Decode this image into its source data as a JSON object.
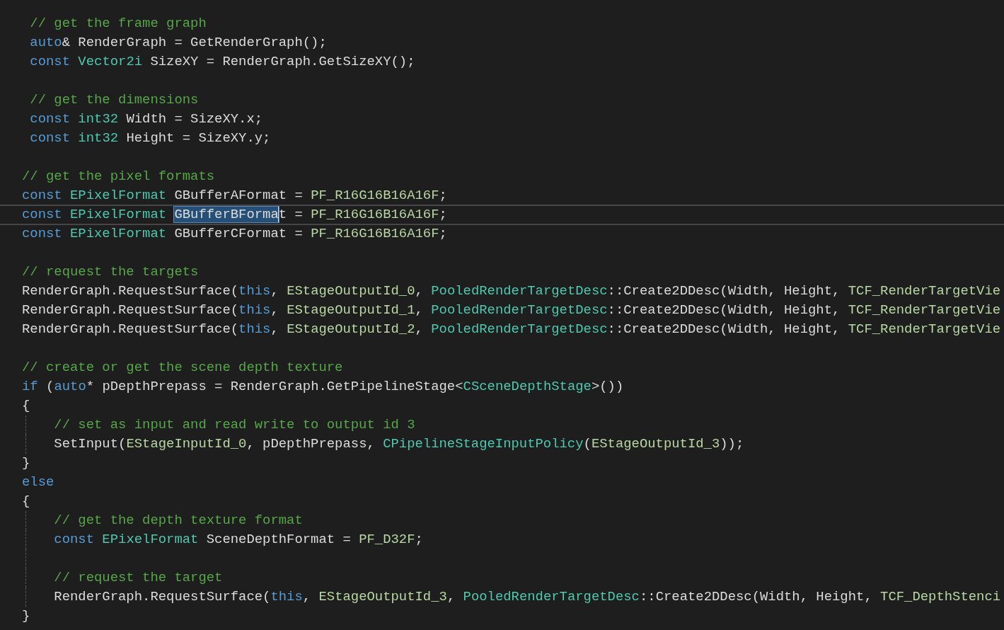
{
  "editor": {
    "lines": [
      {
        "current": false,
        "guide": false,
        "tokens": [
          {
            "kind": "comment",
            "text": " // get the frame graph"
          }
        ]
      },
      {
        "current": false,
        "guide": false,
        "tokens": [
          {
            "kind": "keyword",
            "text": " auto"
          },
          {
            "kind": "plain",
            "text": "& RenderGraph = GetRenderGraph();"
          }
        ]
      },
      {
        "current": false,
        "guide": false,
        "tokens": [
          {
            "kind": "keyword",
            "text": " const"
          },
          {
            "kind": "type",
            "text": " Vector2i"
          },
          {
            "kind": "plain",
            "text": " SizeXY = RenderGraph.GetSizeXY();"
          }
        ]
      },
      {
        "current": false,
        "guide": false
      },
      {
        "current": false,
        "guide": false,
        "tokens": [
          {
            "kind": "comment",
            "text": " // get the dimensions"
          }
        ]
      },
      {
        "current": false,
        "guide": false,
        "tokens": [
          {
            "kind": "keyword",
            "text": " const"
          },
          {
            "kind": "type",
            "text": " int32"
          },
          {
            "kind": "plain",
            "text": " Width = SizeXY.x;"
          }
        ]
      },
      {
        "current": false,
        "guide": false,
        "tokens": [
          {
            "kind": "keyword",
            "text": " const"
          },
          {
            "kind": "type",
            "text": " int32"
          },
          {
            "kind": "plain",
            "text": " Height = SizeXY.y;"
          }
        ]
      },
      {
        "current": false,
        "guide": false
      },
      {
        "current": false,
        "guide": false,
        "tokens": [
          {
            "kind": "comment",
            "text": "// get the pixel formats"
          }
        ]
      },
      {
        "current": false,
        "guide": false,
        "tokens": [
          {
            "kind": "keyword",
            "text": "const"
          },
          {
            "kind": "type",
            "text": " EPixelFormat"
          },
          {
            "kind": "plain",
            "text": " GBufferAFormat = "
          },
          {
            "kind": "enum",
            "text": "PF_R16G16B16A16F"
          },
          {
            "kind": "plain",
            "text": ";"
          }
        ]
      },
      {
        "current": true,
        "guide": false,
        "tokens": [
          {
            "kind": "keyword",
            "text": "const"
          },
          {
            "kind": "type",
            "text": " EPixelFormat "
          },
          {
            "kind": "selection",
            "text": "GBufferBForma"
          },
          {
            "kind": "plain",
            "text": "t = "
          },
          {
            "kind": "enum",
            "text": "PF_R16G16B16A16F"
          },
          {
            "kind": "plain",
            "text": ";"
          }
        ]
      },
      {
        "current": false,
        "guide": false,
        "tokens": [
          {
            "kind": "keyword",
            "text": "const"
          },
          {
            "kind": "type",
            "text": " EPixelFormat"
          },
          {
            "kind": "plain",
            "text": " GBufferCFormat = "
          },
          {
            "kind": "enum",
            "text": "PF_R16G16B16A16F"
          },
          {
            "kind": "plain",
            "text": ";"
          }
        ]
      },
      {
        "current": false,
        "guide": false
      },
      {
        "current": false,
        "guide": false,
        "tokens": [
          {
            "kind": "comment",
            "text": "// request the targets"
          }
        ]
      },
      {
        "current": false,
        "guide": false,
        "tokens": [
          {
            "kind": "plain",
            "text": "RenderGraph.RequestSurface("
          },
          {
            "kind": "keyword",
            "text": "this"
          },
          {
            "kind": "plain",
            "text": ", "
          },
          {
            "kind": "enum",
            "text": "EStageOutputId_0"
          },
          {
            "kind": "plain",
            "text": ", "
          },
          {
            "kind": "type",
            "text": "PooledRenderTargetDesc"
          },
          {
            "kind": "plain",
            "text": "::Create2DDesc(Width, Height, "
          },
          {
            "kind": "enum",
            "text": "TCF_RenderTargetVie"
          }
        ]
      },
      {
        "current": false,
        "guide": false,
        "tokens": [
          {
            "kind": "plain",
            "text": "RenderGraph.RequestSurface("
          },
          {
            "kind": "keyword",
            "text": "this"
          },
          {
            "kind": "plain",
            "text": ", "
          },
          {
            "kind": "enum",
            "text": "EStageOutputId_1"
          },
          {
            "kind": "plain",
            "text": ", "
          },
          {
            "kind": "type",
            "text": "PooledRenderTargetDesc"
          },
          {
            "kind": "plain",
            "text": "::Create2DDesc(Width, Height, "
          },
          {
            "kind": "enum",
            "text": "TCF_RenderTargetVie"
          }
        ]
      },
      {
        "current": false,
        "guide": false,
        "tokens": [
          {
            "kind": "plain",
            "text": "RenderGraph.RequestSurface("
          },
          {
            "kind": "keyword",
            "text": "this"
          },
          {
            "kind": "plain",
            "text": ", "
          },
          {
            "kind": "enum",
            "text": "EStageOutputId_2"
          },
          {
            "kind": "plain",
            "text": ", "
          },
          {
            "kind": "type",
            "text": "PooledRenderTargetDesc"
          },
          {
            "kind": "plain",
            "text": "::Create2DDesc(Width, Height, "
          },
          {
            "kind": "enum",
            "text": "TCF_RenderTargetVie"
          }
        ]
      },
      {
        "current": false,
        "guide": false
      },
      {
        "current": false,
        "guide": false,
        "tokens": [
          {
            "kind": "comment",
            "text": "// create or get the scene depth texture"
          }
        ]
      },
      {
        "current": false,
        "guide": false,
        "tokens": [
          {
            "kind": "keyword",
            "text": "if"
          },
          {
            "kind": "plain",
            "text": " ("
          },
          {
            "kind": "keyword",
            "text": "auto"
          },
          {
            "kind": "plain",
            "text": "* pDepthPrepass = RenderGraph.GetPipelineStage<"
          },
          {
            "kind": "type",
            "text": "CSceneDepthStage"
          },
          {
            "kind": "plain",
            "text": ">())"
          }
        ]
      },
      {
        "current": false,
        "guide": false,
        "tokens": [
          {
            "kind": "plain",
            "text": "{"
          }
        ]
      },
      {
        "current": false,
        "guide": true,
        "tokens": [
          {
            "kind": "comment",
            "text": "    // set as input and read write to output id 3"
          }
        ]
      },
      {
        "current": false,
        "guide": true,
        "tokens": [
          {
            "kind": "plain",
            "text": "    SetInput("
          },
          {
            "kind": "enum",
            "text": "EStageInputId_0"
          },
          {
            "kind": "plain",
            "text": ", pDepthPrepass, "
          },
          {
            "kind": "type",
            "text": "CPipelineStageInputPolicy"
          },
          {
            "kind": "plain",
            "text": "("
          },
          {
            "kind": "enum",
            "text": "EStageOutputId_3"
          },
          {
            "kind": "plain",
            "text": "));"
          }
        ]
      },
      {
        "current": false,
        "guide": false,
        "tokens": [
          {
            "kind": "plain",
            "text": "}"
          }
        ]
      },
      {
        "current": false,
        "guide": false,
        "tokens": [
          {
            "kind": "keyword",
            "text": "else"
          }
        ]
      },
      {
        "current": false,
        "guide": false,
        "tokens": [
          {
            "kind": "plain",
            "text": "{"
          }
        ]
      },
      {
        "current": false,
        "guide": true,
        "tokens": [
          {
            "kind": "comment",
            "text": "    // get the depth texture format"
          }
        ]
      },
      {
        "current": false,
        "guide": true,
        "tokens": [
          {
            "kind": "keyword",
            "text": "    const"
          },
          {
            "kind": "type",
            "text": " EPixelFormat"
          },
          {
            "kind": "plain",
            "text": " SceneDepthFormat = "
          },
          {
            "kind": "enum",
            "text": "PF_D32F"
          },
          {
            "kind": "plain",
            "text": ";"
          }
        ]
      },
      {
        "current": false,
        "guide": true
      },
      {
        "current": false,
        "guide": true,
        "tokens": [
          {
            "kind": "comment",
            "text": "    // request the target"
          }
        ]
      },
      {
        "current": false,
        "guide": true,
        "tokens": [
          {
            "kind": "plain",
            "text": "    RenderGraph.RequestSurface("
          },
          {
            "kind": "keyword",
            "text": "this"
          },
          {
            "kind": "plain",
            "text": ", "
          },
          {
            "kind": "enum",
            "text": "EStageOutputId_3"
          },
          {
            "kind": "plain",
            "text": ", "
          },
          {
            "kind": "type",
            "text": "PooledRenderTargetDesc"
          },
          {
            "kind": "plain",
            "text": "::Create2DDesc(Width, Height, "
          },
          {
            "kind": "enum",
            "text": "TCF_DepthStenci"
          }
        ]
      },
      {
        "current": false,
        "guide": false,
        "tokens": [
          {
            "kind": "plain",
            "text": "}"
          }
        ]
      }
    ]
  }
}
